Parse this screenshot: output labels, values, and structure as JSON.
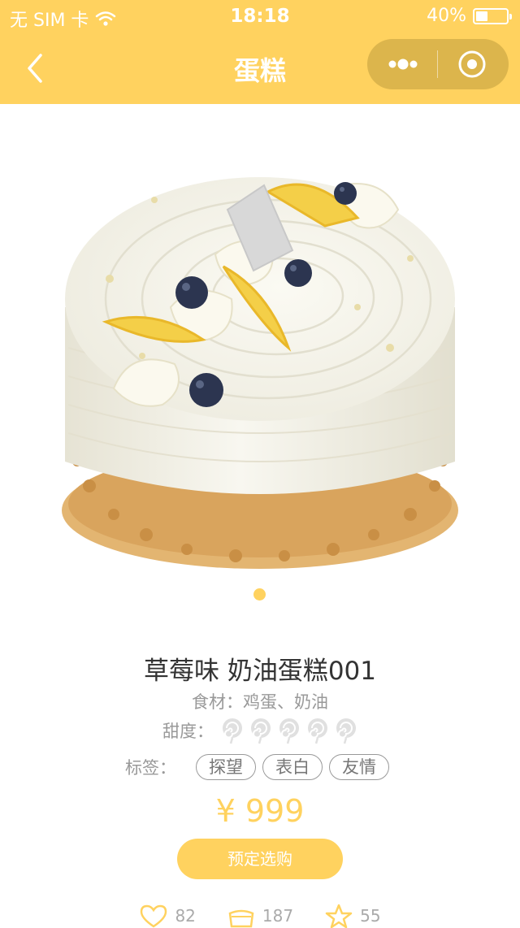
{
  "status_bar": {
    "carrier": "无 SIM 卡",
    "time": "18:18",
    "battery": "40%",
    "battery_level": 0.4
  },
  "navbar": {
    "title": "蛋糕",
    "back_icon": "chevron-left-icon",
    "more_icon": "more-dots-icon",
    "close_icon": "target-circle-icon"
  },
  "carousel": {
    "image_subject": "cake-photo",
    "active_index": 0,
    "count": 1
  },
  "product": {
    "title": "草莓味 奶油蛋糕001",
    "ingredients": "食材：鸡蛋、奶油",
    "sweetness_label": "甜度：",
    "sweetness_level": 0,
    "sweetness_max": 5,
    "tags_label": "标签：",
    "tags": [
      "探望",
      "表白",
      "友情"
    ],
    "price": "¥ 999",
    "order_button": "预定选购"
  },
  "stats": {
    "likes": "82",
    "cake_count": "187",
    "stars": "55"
  },
  "colors": {
    "accent": "#ffd25f",
    "muted_text": "#999999",
    "lollipop": "#e0e0e0"
  }
}
